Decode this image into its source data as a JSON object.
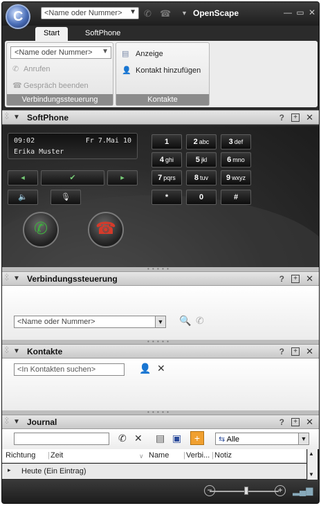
{
  "title_bar": {
    "search_placeholder": "<Name oder Nummer>",
    "app_title": "OpenScape"
  },
  "tabs": [
    "Start",
    "SoftPhone"
  ],
  "ribbon": {
    "connection_group": {
      "combo_placeholder": "<Name oder Nummer>",
      "call_label": "Anrufen",
      "end_call_label": "Gespräch beenden",
      "caption": "Verbindungssteuerung"
    },
    "contacts_group": {
      "view_label": "Anzeige",
      "add_contact_label": "Kontakt hinzufügen",
      "caption": "Kontakte"
    }
  },
  "softphone": {
    "title": "SoftPhone",
    "display": {
      "time": "09:02",
      "date": "Fr 7.Mai 10",
      "name": "Erika Muster"
    },
    "keys": [
      {
        "k": "1",
        "s": ""
      },
      {
        "k": "2",
        "s": "abc"
      },
      {
        "k": "3",
        "s": "def"
      },
      {
        "k": "4",
        "s": "ghi"
      },
      {
        "k": "5",
        "s": "jkl"
      },
      {
        "k": "6",
        "s": "mno"
      },
      {
        "k": "7",
        "s": "pqrs"
      },
      {
        "k": "8",
        "s": "tuv"
      },
      {
        "k": "9",
        "s": "wxyz"
      },
      {
        "k": "*",
        "s": ""
      },
      {
        "k": "0",
        "s": ""
      },
      {
        "k": "#",
        "s": ""
      }
    ]
  },
  "connection_panel": {
    "title": "Verbindungssteuerung",
    "combo_placeholder": "<Name oder Nummer>"
  },
  "contacts_panel": {
    "title": "Kontakte",
    "search_placeholder": "<In Kontakten suchen>"
  },
  "journal_panel": {
    "title": "Journal",
    "filter_value": "Alle",
    "columns": [
      "Richtung",
      "Zeit",
      "Name",
      "Verbi...",
      "Notiz"
    ],
    "group_row": "Heute (Ein Eintrag)"
  },
  "colors": {
    "accent": "#f0a030",
    "call_green": "#3fae3f",
    "hangup_red": "#d63a2a"
  }
}
